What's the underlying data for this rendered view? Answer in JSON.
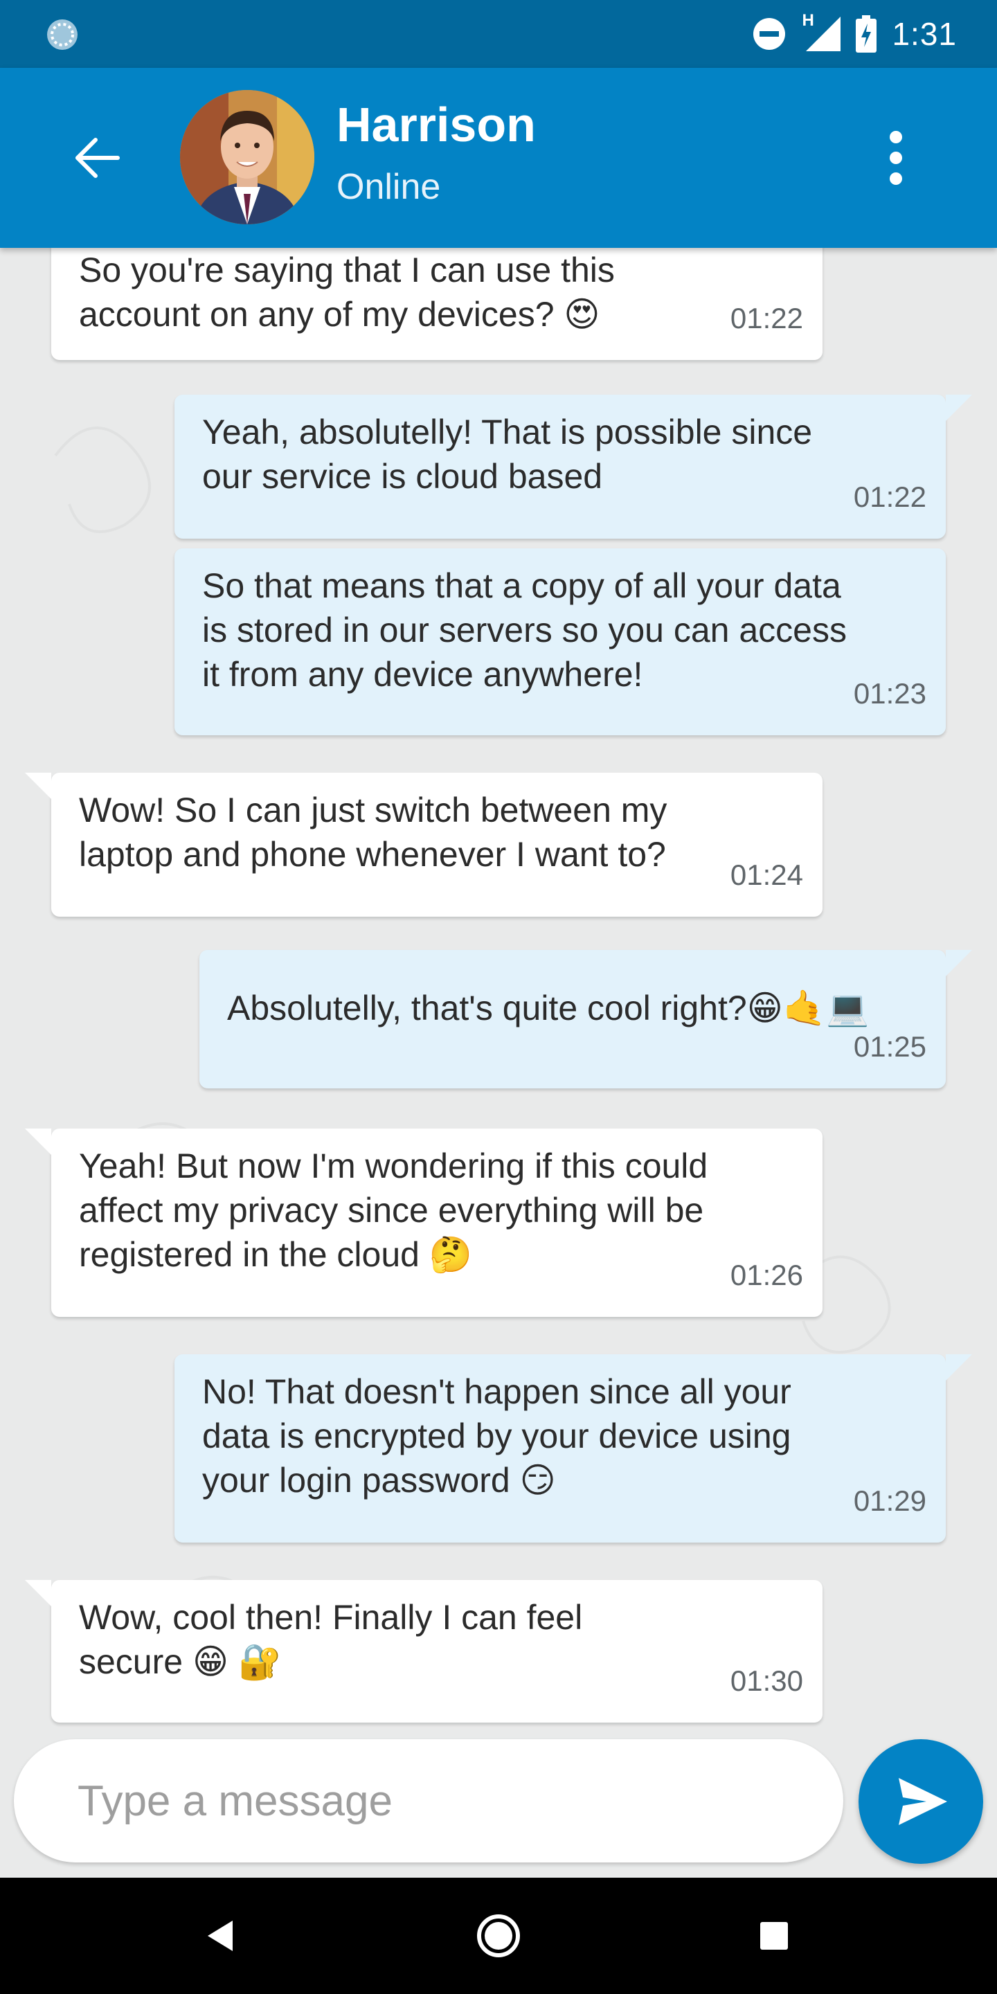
{
  "status_bar": {
    "time": "1:31",
    "network_label": "H",
    "icons": [
      "sync-icon",
      "do-not-disturb-icon",
      "signal-icon",
      "battery-charging-icon"
    ]
  },
  "header": {
    "contact_name": "Harrison",
    "contact_status": "Online",
    "back_icon": "arrow-back-icon",
    "menu_icon": "more-vertical-icon"
  },
  "messages": [
    {
      "direction": "in",
      "text": "So you're saying that I can use this\naccount on any of my devices? 😍",
      "time": "01:22"
    },
    {
      "direction": "out",
      "text": "Yeah, absolutelly! That is possible since\nour service is cloud based",
      "time": "01:22"
    },
    {
      "direction": "out",
      "text": "So that means that a copy of all your data\nis stored in our servers so you can access\nit from any device anywhere!",
      "time": "01:23"
    },
    {
      "direction": "in",
      "text": "Wow! So I can just switch between my\nlaptop and phone whenever I want to?",
      "time": "01:24"
    },
    {
      "direction": "out",
      "text": "Absolutelly, that's quite cool right?😁🤙💻",
      "time": "01:25"
    },
    {
      "direction": "in",
      "text": "Yeah! But now I'm wondering if this could\naffect my privacy since everything will be\nregistered in the cloud 🤔",
      "time": "01:26"
    },
    {
      "direction": "out",
      "text": "No! That doesn't happen since all your\ndata is encrypted by your device using\nyour login password 😏",
      "time": "01:29"
    },
    {
      "direction": "in",
      "text": "Wow, cool then! Finally I can feel\nsecure 😁 🔐",
      "time": "01:30"
    }
  ],
  "composer": {
    "placeholder": "Type a message",
    "value": "",
    "send_icon": "send-icon"
  },
  "nav_bar": {
    "icons": [
      "nav-back-icon",
      "nav-home-icon",
      "nav-recents-icon"
    ]
  },
  "colors": {
    "status_bar": "#02689c",
    "app_bar": "#0383c5",
    "incoming_bubble": "#ffffff",
    "outgoing_bubble": "#e2f2fb",
    "chat_background": "#e9eaea"
  }
}
